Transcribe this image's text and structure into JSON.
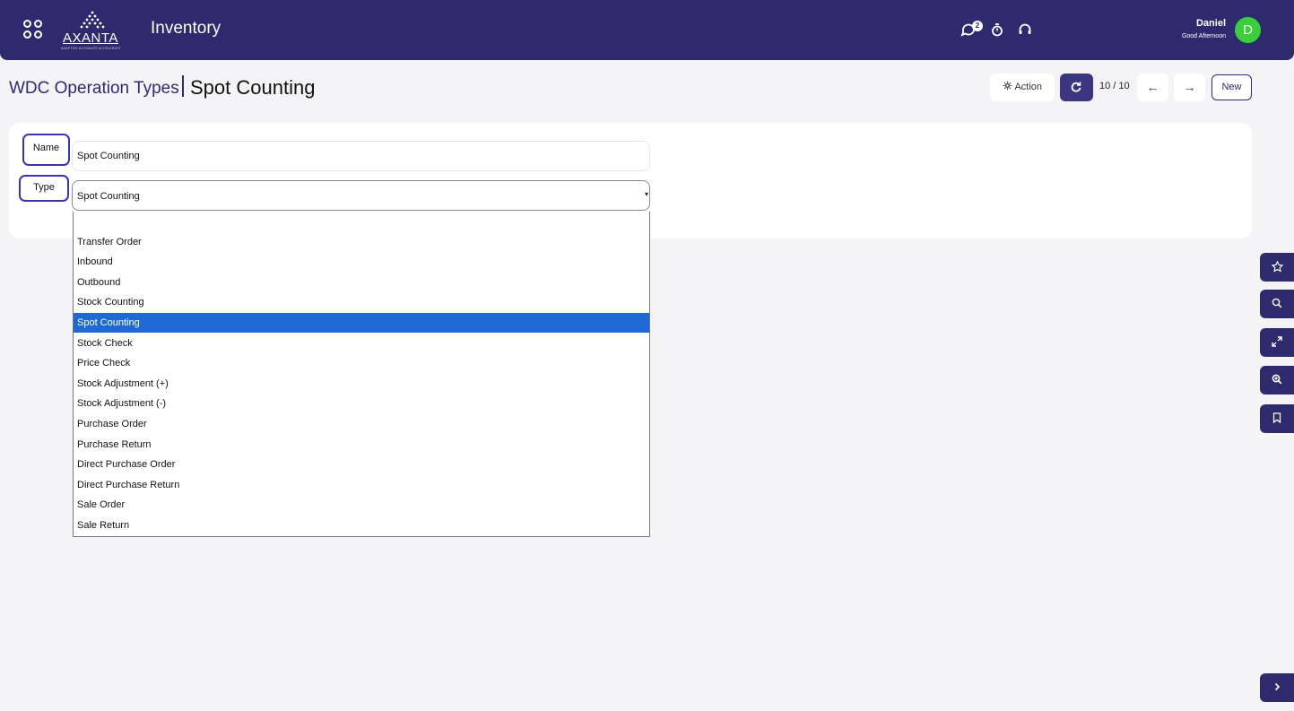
{
  "header": {
    "logo_text": "AXANTA",
    "logo_tagline": "ADAPTIVE AUTOMATE ACCELERATE",
    "app_title": "Inventory",
    "chat_badge": "2",
    "user_name": "Daniel",
    "greeting": "Good Afternoon",
    "avatar_initial": "D",
    "avatar_color": "#3ccf3c",
    "brand_color": "#2e2a6e"
  },
  "breadcrumb": {
    "root": "WDC Operation Types",
    "current": "Spot Counting"
  },
  "toolbar": {
    "action_label": "Action",
    "pager": "10 / 10",
    "prev_label": "←",
    "next_label": "→",
    "new_label": "New"
  },
  "form": {
    "name_label": "Name",
    "name_value": "Spot Counting",
    "type_label": "Type",
    "type_value": "Spot Counting"
  },
  "dropdown": {
    "options": [
      "",
      "Transfer Order",
      "Inbound",
      "Outbound",
      "Stock Counting",
      "Spot Counting",
      "Stock Check",
      "Price Check",
      "Stock Adjustment (+)",
      "Stock Adjustment (-)",
      "Purchase Order",
      "Purchase Return",
      "Direct Purchase Order",
      "Direct Purchase Return",
      "Sale Order",
      "Sale Return"
    ],
    "selected": "Spot Counting"
  },
  "rail": {
    "icons": [
      "star-icon",
      "search-icon",
      "expand-icon",
      "zoom-icon",
      "bookmark-icon",
      "chevron-right-icon"
    ]
  }
}
